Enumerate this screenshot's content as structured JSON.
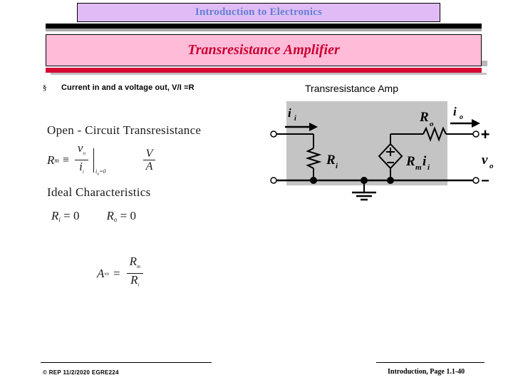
{
  "header": {
    "title": "Introduction to Electronics",
    "subtitle": "Transresistance Amplifier"
  },
  "bullet": {
    "marker": "§",
    "text": "Current in and a voltage out, V/I =R"
  },
  "math": {
    "open_circuit_heading": "Open - Circuit Transresistance",
    "rm_symbol": "R",
    "rm_sub": "m",
    "rm_relation": "≡",
    "rm_numerator_var": "v",
    "rm_numerator_sub": "o",
    "rm_denominator_var": "i",
    "rm_denominator_sub": "i",
    "rm_condition": "i",
    "rm_condition_sub": "o",
    "rm_condition_value": "=0",
    "units_numerator": "V",
    "units_denominator": "A",
    "ideal_heading": "Ideal Characteristics",
    "ideal_ri": "R",
    "ideal_ri_sub": "i",
    "ideal_ri_value": "= 0",
    "ideal_ro": "R",
    "ideal_ro_sub": "o",
    "ideal_ro_value": "= 0",
    "avo_symbol": "A",
    "avo_sub": "vo",
    "avo_equals": "=",
    "avo_numerator": "R",
    "avo_numerator_sub": "m",
    "avo_denominator": "R",
    "avo_denominator_sub": "i"
  },
  "circuit": {
    "title": "Transresistance Amp",
    "input_current_label": "i",
    "input_current_sub": "i",
    "input_resistor_label": "R",
    "input_resistor_sub": "i",
    "output_resistor_label": "R",
    "output_resistor_sub": "o",
    "output_current_label": "i",
    "output_current_sub": "o",
    "source_label": "R",
    "source_sub_m": "m",
    "source_label_i": "i",
    "source_sub_i": "i",
    "source_plus": "+",
    "source_minus": "−",
    "output_plus": "+",
    "output_minus": "−",
    "output_voltage_label": "v",
    "output_voltage_sub": "o",
    "box_fill": "#c4c4c4"
  },
  "footer": {
    "left": "© REP  11/2/2020  EGRE224",
    "right": "Introduction, Page 1.1-40"
  },
  "colors": {
    "title_bg": "#e0bbf5",
    "title_fg": "#6f78d8",
    "subtitle_bg": "#ffbcd9",
    "subtitle_fg": "#cc0033",
    "red_bar": "#d60b36"
  }
}
